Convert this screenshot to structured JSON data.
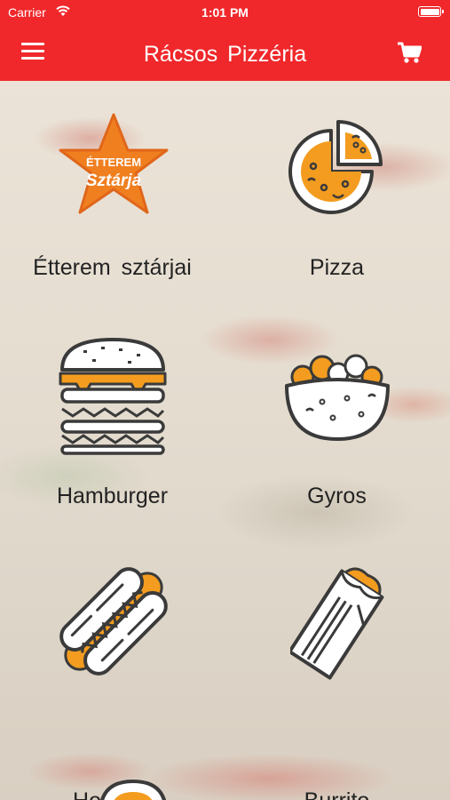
{
  "status_bar": {
    "carrier": "Carrier",
    "time": "1:01 PM"
  },
  "header": {
    "title": "Rácsos Pizzéria",
    "menu_icon": "hamburger-menu-icon",
    "cart_icon": "shopping-cart-icon"
  },
  "logo": {
    "line1": "ÉTTEREM",
    "line2": "Sztárja"
  },
  "categories": [
    {
      "label": "Étterem sztárjai",
      "icon": "star-badge-icon"
    },
    {
      "label": "Pizza",
      "icon": "pizza-icon"
    },
    {
      "label": "Hamburger",
      "icon": "burger-icon"
    },
    {
      "label": "Gyros",
      "icon": "gyros-bowl-icon"
    },
    {
      "label": "Hot-dog",
      "icon": "hotdog-icon"
    },
    {
      "label": "Burrito",
      "icon": "burrito-icon"
    }
  ],
  "colors": {
    "accent": "#f0282b",
    "icon_orange": "#f39c1f",
    "icon_outline": "#3a3a3a"
  }
}
